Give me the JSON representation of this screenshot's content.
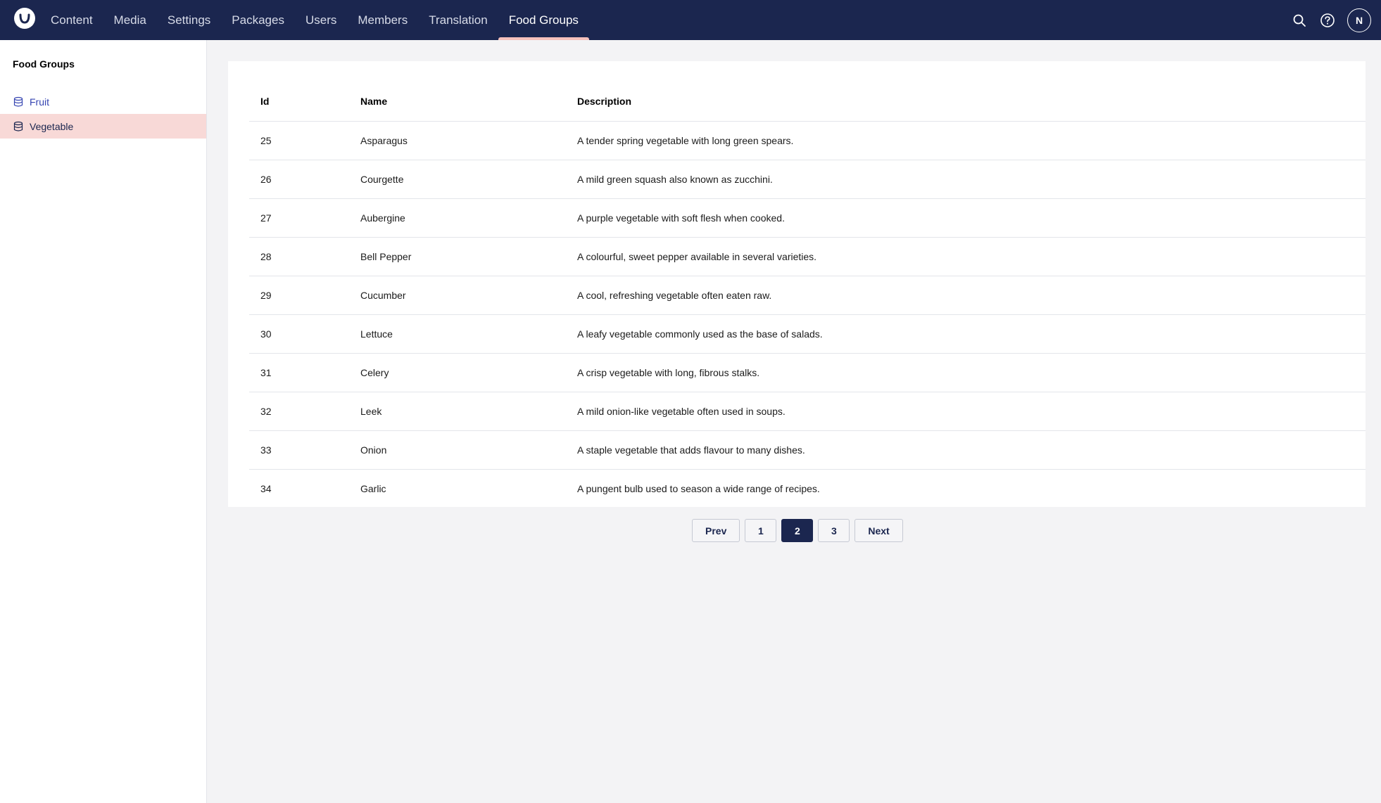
{
  "header": {
    "nav": [
      {
        "label": "Content",
        "active": false
      },
      {
        "label": "Media",
        "active": false
      },
      {
        "label": "Settings",
        "active": false
      },
      {
        "label": "Packages",
        "active": false
      },
      {
        "label": "Users",
        "active": false
      },
      {
        "label": "Members",
        "active": false
      },
      {
        "label": "Translation",
        "active": false
      },
      {
        "label": "Food Groups",
        "active": true
      }
    ],
    "avatar_initial": "N",
    "colors": {
      "bar": "#1b264f",
      "active_indicator": "#f5c1bc"
    }
  },
  "sidebar": {
    "title": "Food Groups",
    "items": [
      {
        "label": "Fruit",
        "icon": "database-icon",
        "selected": false
      },
      {
        "label": "Vegetable",
        "icon": "database-icon",
        "selected": true
      }
    ]
  },
  "table": {
    "columns": [
      "Id",
      "Name",
      "Description"
    ],
    "rows": [
      {
        "id": "25",
        "name": "Asparagus",
        "description": "A tender spring vegetable with long green spears."
      },
      {
        "id": "26",
        "name": "Courgette",
        "description": "A mild green squash also known as zucchini."
      },
      {
        "id": "27",
        "name": "Aubergine",
        "description": "A purple vegetable with soft flesh when cooked."
      },
      {
        "id": "28",
        "name": "Bell Pepper",
        "description": "A colourful, sweet pepper available in several varieties."
      },
      {
        "id": "29",
        "name": "Cucumber",
        "description": "A cool, refreshing vegetable often eaten raw."
      },
      {
        "id": "30",
        "name": "Lettuce",
        "description": "A leafy vegetable commonly used as the base of salads."
      },
      {
        "id": "31",
        "name": "Celery",
        "description": "A crisp vegetable with long, fibrous stalks."
      },
      {
        "id": "32",
        "name": "Leek",
        "description": "A mild onion-like vegetable often used in soups."
      },
      {
        "id": "33",
        "name": "Onion",
        "description": "A staple vegetable that adds flavour to many dishes."
      },
      {
        "id": "34",
        "name": "Garlic",
        "description": "A pungent bulb used to season a wide range of recipes."
      }
    ]
  },
  "pagination": {
    "prev_label": "Prev",
    "next_label": "Next",
    "pages": [
      "1",
      "2",
      "3"
    ],
    "current": "2"
  }
}
